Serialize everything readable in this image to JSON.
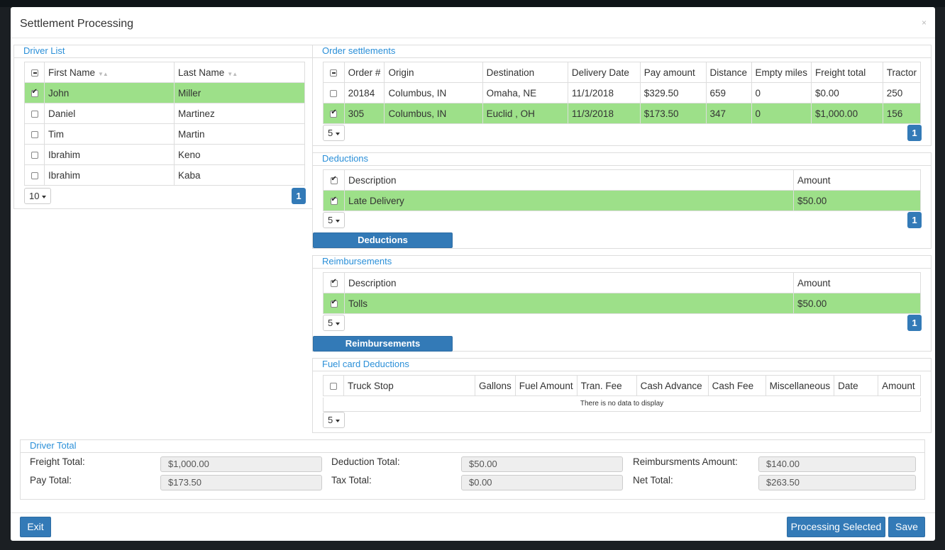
{
  "modal": {
    "title": "Settlement Processing",
    "close": "×"
  },
  "driver_list": {
    "title": "Driver List",
    "headers": [
      "First Name",
      "Last Name"
    ],
    "rows": [
      {
        "first": "John",
        "last": "Miller",
        "checked": true
      },
      {
        "first": "Daniel",
        "last": "Martinez",
        "checked": false
      },
      {
        "first": "Tim",
        "last": "Martin",
        "checked": false
      },
      {
        "first": "Ibrahim",
        "last": "Keno",
        "checked": false
      },
      {
        "first": "Ibrahim",
        "last": "Kaba",
        "checked": false
      }
    ],
    "page_size": "10",
    "page": "1"
  },
  "orders": {
    "title": "Order settlements",
    "headers": [
      "Order #",
      "Origin",
      "Destination",
      "Delivery Date",
      "Pay amount",
      "Distance",
      "Empty miles",
      "Freight total",
      "Tractor"
    ],
    "rows": [
      {
        "cells": [
          "20184",
          "Columbus, IN",
          "Omaha, NE",
          "11/1/2018",
          "$329.50",
          "659",
          "0",
          "$0.00",
          "250"
        ],
        "checked": false
      },
      {
        "cells": [
          "305",
          "Columbus, IN",
          "Euclid , OH",
          "11/3/2018",
          "$173.50",
          "347",
          "0",
          "$1,000.00",
          "156"
        ],
        "checked": true
      }
    ],
    "page_size": "5",
    "page": "1"
  },
  "deductions": {
    "title": "Deductions",
    "headers": [
      "Description",
      "Amount"
    ],
    "rows": [
      {
        "cells": [
          "Late Delivery",
          "$50.00"
        ],
        "checked": true
      }
    ],
    "page_size": "5",
    "page": "1",
    "button": "Deductions"
  },
  "reimbursements": {
    "title": "Reimbursements",
    "headers": [
      "Description",
      "Amount"
    ],
    "rows": [
      {
        "cells": [
          "Tolls",
          "$50.00"
        ],
        "checked": true
      }
    ],
    "page_size": "5",
    "page": "1",
    "button": "Reimbursements"
  },
  "fuel": {
    "title": "Fuel card Deductions",
    "headers": [
      "Truck Stop",
      "Gallons",
      "Fuel Amount",
      "Tran. Fee",
      "Cash Advance",
      "Cash Fee",
      "Miscellaneous",
      "Date",
      "Amount"
    ],
    "empty": "There is no data to display",
    "page_size": "5"
  },
  "driver_total": {
    "title": "Driver Total",
    "freight_label": "Freight Total:",
    "freight_value": "$1,000.00",
    "pay_label": "Pay Total:",
    "pay_value": "$173.50",
    "deduction_label": "Deduction Total:",
    "deduction_value": "$50.00",
    "tax_label": "Tax Total:",
    "tax_value": "$0.00",
    "reimb_label": "Reimbursments Amount:",
    "reimb_value": "$140.00",
    "net_label": "Net Total:",
    "net_value": "$263.50"
  },
  "footer": {
    "exit": "Exit",
    "process": "Processing Selected",
    "save": "Save"
  },
  "colors": {
    "accent": "#337ab7",
    "title_blue": "#2a8fd8",
    "selected_row": "#9de089"
  }
}
